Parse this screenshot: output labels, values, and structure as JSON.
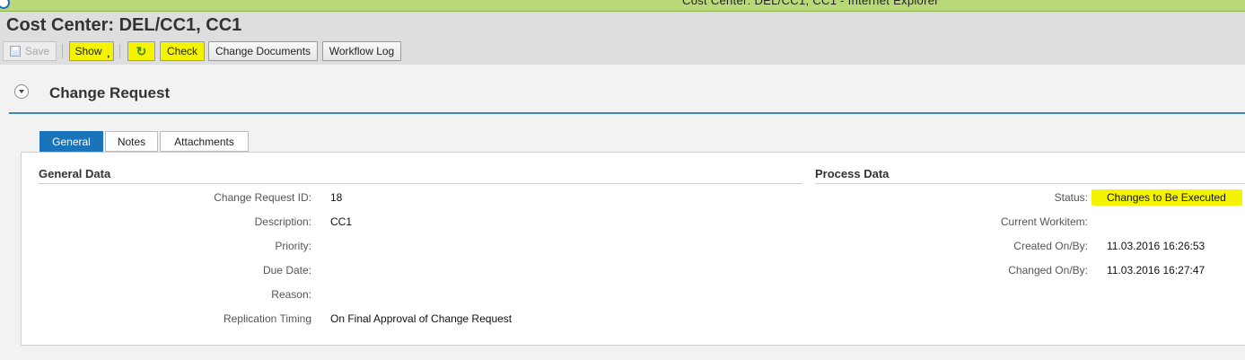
{
  "window": {
    "title": "Cost Center: DEL/CC1, CC1 - Internet Explorer"
  },
  "page": {
    "title": "Cost Center: DEL/CC1, CC1"
  },
  "toolbar": {
    "save": "Save",
    "show": "Show",
    "check": "Check",
    "change_documents": "Change Documents",
    "workflow_log": "Workflow Log"
  },
  "section": {
    "title": "Change Request"
  },
  "tabs": {
    "general": "General",
    "notes": "Notes",
    "attachments": "Attachments"
  },
  "general_data": {
    "title": "General Data",
    "fields": {
      "id_label": "Change Request ID:",
      "id_value": "18",
      "desc_label": "Description:",
      "desc_value": "CC1",
      "priority_label": "Priority:",
      "priority_value": "",
      "due_label": "Due Date:",
      "due_value": "",
      "reason_label": "Reason:",
      "reason_value": "",
      "timing_label": "Replication Timing",
      "timing_value": "On Final Approval of Change Request"
    }
  },
  "process_data": {
    "title": "Process Data",
    "fields": {
      "status_label": "Status:",
      "status_value": "Changes to Be Executed",
      "workitem_label": "Current Workitem:",
      "workitem_value": "",
      "created_label": "Created On/By:",
      "created_value": "11.03.2016 16:26:53",
      "changed_label": "Changed On/By:",
      "changed_value": "11.03.2016 16:27:47"
    }
  },
  "colors": {
    "highlight": "#f4f400",
    "accent": "#1b74b9",
    "window_bar": "#b9d978"
  },
  "icons": {
    "save": "floppy-disk-icon",
    "refresh": "refresh-icon",
    "collapse": "collapse-icon",
    "dropdown": "dropdown-arrow-icon"
  }
}
